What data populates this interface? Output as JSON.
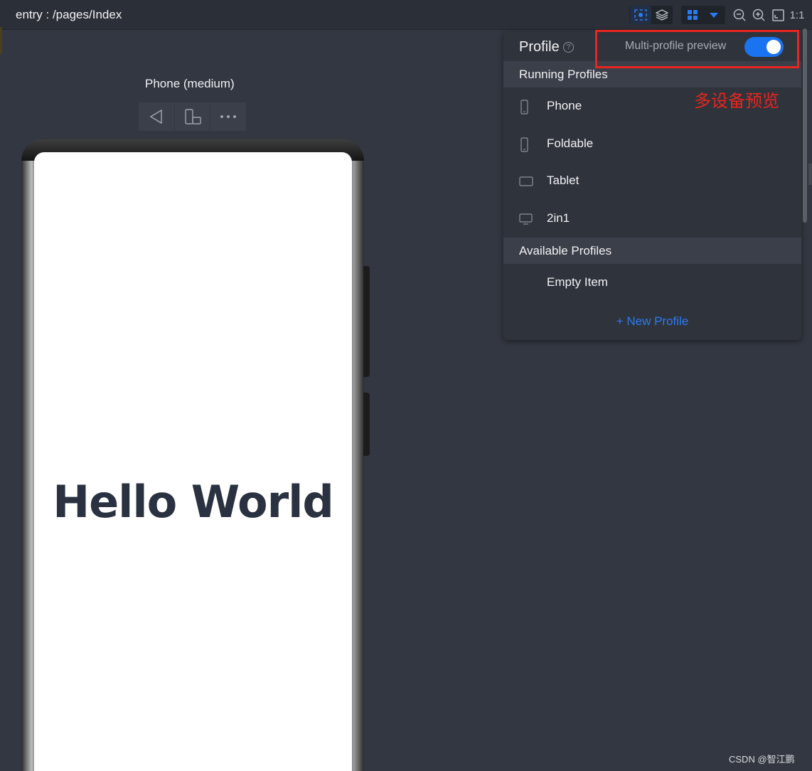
{
  "window": {
    "title": "entry : /pages/Index"
  },
  "toolbar": {
    "icons": [
      "inspector-icon",
      "layers-icon",
      "grid-icon",
      "dropdown-arrow-icon",
      "zoom-out-icon",
      "zoom-in-icon",
      "fit-screen-icon"
    ],
    "ratio_label": "1:1"
  },
  "device": {
    "label": "Phone (medium)",
    "screen_text": "Hello World",
    "tools": [
      "back-icon",
      "rotate-device-icon",
      "more-icon"
    ]
  },
  "profile_panel": {
    "title": "Profile",
    "help_symbol": "?",
    "multi_profile_label": "Multi-profile preview",
    "multi_profile_enabled": true,
    "running_section": "Running Profiles",
    "running_profiles": [
      {
        "label": "Phone",
        "icon": "phone-icon"
      },
      {
        "label": "Foldable",
        "icon": "foldable-icon"
      },
      {
        "label": "Tablet",
        "icon": "tablet-icon"
      },
      {
        "label": "2in1",
        "icon": "monitor-icon"
      }
    ],
    "available_section": "Available Profiles",
    "available_profiles": [
      {
        "label": "Empty Item"
      }
    ],
    "new_profile": "+ New Profile"
  },
  "annotation": {
    "text": "多设备预览",
    "color": "#e8261f"
  },
  "watermark": "CSDN @智江鹏",
  "colors": {
    "accent": "#1a73f0",
    "link": "#2b7bf0",
    "background": "#333741",
    "panel": "#2f333b"
  }
}
